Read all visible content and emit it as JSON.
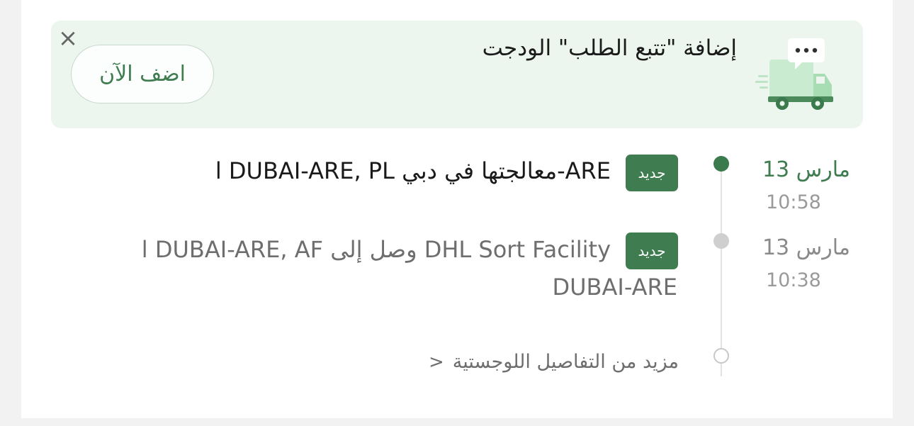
{
  "banner": {
    "title": "إضافة \"تتبع الطلب\" الودجت",
    "add_button": "اضف الآن",
    "close_glyph": "×",
    "icon": "delivery-truck-icon",
    "accent": "#3f7d51",
    "background": "#ecf6ef"
  },
  "timeline": {
    "events": [
      {
        "date": "مارس 13",
        "time": "10:58",
        "badge": "جديد",
        "line1": "ARE-معالجتها في دبي DUBAI-ARE, PL ا",
        "status": "active"
      },
      {
        "date": "مارس 13",
        "time": "10:38",
        "badge": "جديد",
        "line1": "DHL Sort Facility وصل إلى DUBAI-ARE, AF ا",
        "line2": "DUBAI-ARE",
        "status": "past"
      }
    ],
    "more_link": "مزيد من التفاصيل اللوجستية",
    "more_chevron": "<"
  }
}
